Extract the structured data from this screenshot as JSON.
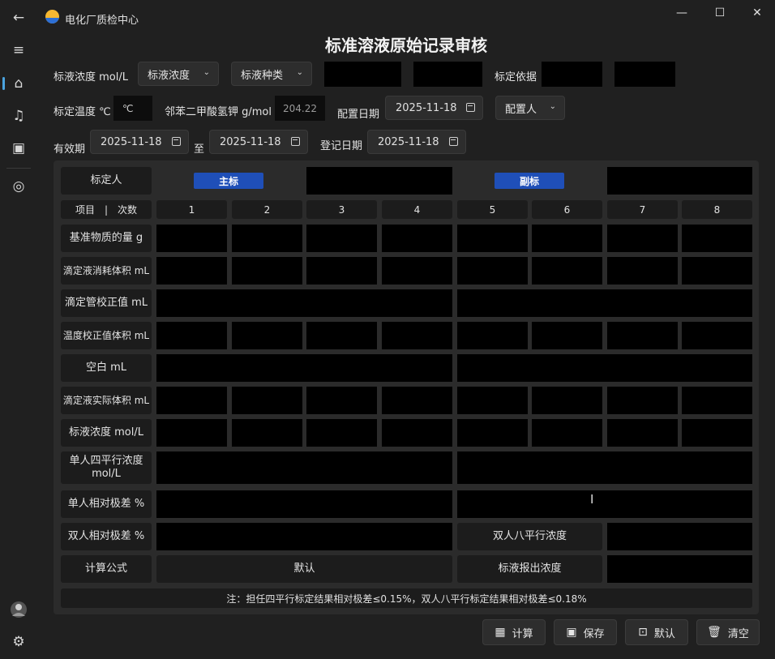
{
  "app": {
    "title": "电化厂质检中心",
    "page_title": "标准溶液原始记录审核"
  },
  "nav": {
    "back_icon": "←",
    "menu_icon": "≡",
    "home_icon": "⌂",
    "music_icon": "♫",
    "film_icon": "▣",
    "camera_icon": "◎",
    "settings_icon": "⚙"
  },
  "window": {
    "min": "—",
    "max": "☐",
    "close": "✕"
  },
  "form": {
    "std_conc_label": "标液浓度 mol/L",
    "std_conc_combo": "标液浓度",
    "std_type_combo": "标液种类",
    "basis_label": "标定依据",
    "temp_label": "标定温度 ℃",
    "temp_unit": "℃",
    "khp_label": "邻苯二甲酸氢钾 g/mol",
    "khp_value": "204.22",
    "prep_date_label": "配置日期",
    "prep_date": "2025-11-18",
    "preparer_combo": "配置人",
    "valid_label": "有效期",
    "valid_from": "2025-11-18",
    "valid_to_label": "至",
    "valid_to": "2025-11-18",
    "reg_date_label": "登记日期",
    "reg_date": "2025-11-18"
  },
  "grid": {
    "calibrator_label": "标定人",
    "main_tag": "主标",
    "sub_tag": "副标",
    "items_header": "项目　|　次数",
    "columns": [
      "1",
      "2",
      "3",
      "4",
      "5",
      "6",
      "7",
      "8"
    ],
    "rows": [
      "基准物质的量 g",
      "滴定液消耗体积 mL",
      "滴定管校正值 mL",
      "温度校正值体积 mL",
      "空白 mL",
      "滴定液实际体积 mL",
      "标液浓度 mol/L",
      "单人四平行浓度\nmol/L",
      "单人相对极差 %",
      "双人相对极差 %",
      "计算公式"
    ],
    "double_eight_label": "双人八平行浓度",
    "formula_default": "默认",
    "reported_conc_label": "标液报出浓度",
    "note": "注：担任四平行标定结果相对极差≤0.15%，双人八平行标定结果相对极差≤0.18%"
  },
  "actions": {
    "calc": "计算",
    "save": "保存",
    "default": "默认",
    "clear": "清空"
  }
}
